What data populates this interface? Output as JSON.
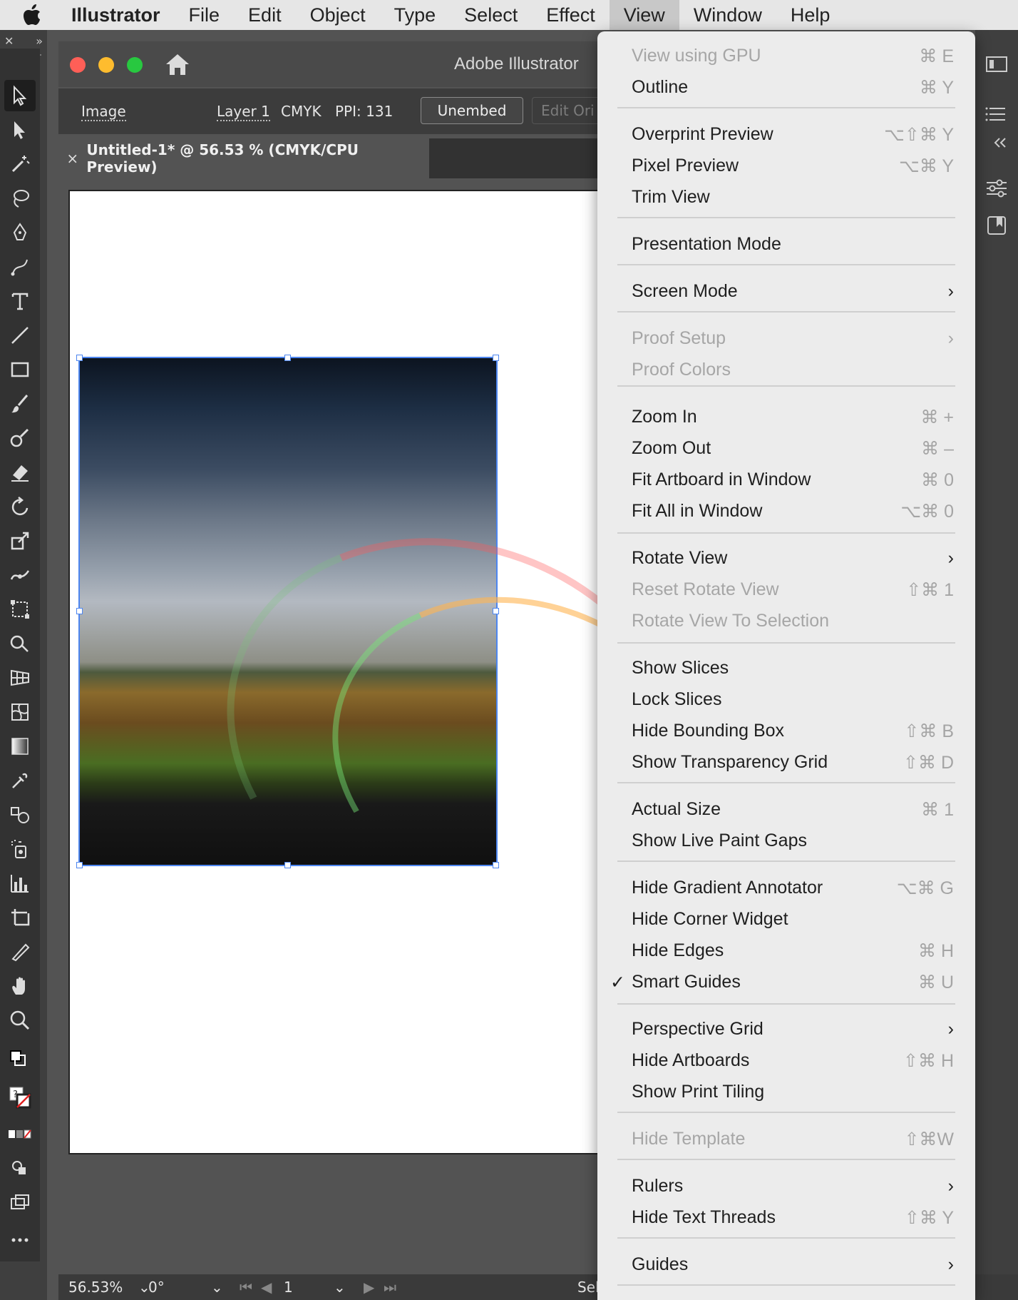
{
  "menubar": {
    "app_name": "Illustrator",
    "items": [
      "File",
      "Edit",
      "Object",
      "Type",
      "Select",
      "Effect",
      "View",
      "Window",
      "Help"
    ],
    "active": "View"
  },
  "window": {
    "title": "Adobe Illustrator"
  },
  "control_bar": {
    "object_type": "Image",
    "layer": "Layer 1",
    "color_mode": "CMYK",
    "ppi": "PPI: 131",
    "unembed_label": "Unembed",
    "edit_original_label": "Edit Ori"
  },
  "document_tab": {
    "close_glyph": "×",
    "title": "Untitled-1* @ 56.53 % (CMYK/CPU Preview)"
  },
  "status_bar": {
    "zoom": "56.53%",
    "rotation": "0°",
    "artboard_number": "1",
    "selection_text": "Sel"
  },
  "view_menu": {
    "check_glyph": "✓",
    "chevron_glyph": "›",
    "items": [
      {
        "label": "View using GPU",
        "shortcut": "⌘ E",
        "disabled": true
      },
      {
        "label": "Outline",
        "shortcut": "⌘ Y"
      },
      {
        "label": "Overprint Preview",
        "shortcut": "⌥⇧⌘ Y"
      },
      {
        "label": "Pixel Preview",
        "shortcut": "⌥⌘ Y"
      },
      {
        "label": "Trim View",
        "shortcut": ""
      },
      {
        "label": "Presentation Mode",
        "shortcut": ""
      },
      {
        "label": "Screen Mode",
        "submenu": true
      },
      {
        "label": "Proof Setup",
        "submenu": true,
        "disabled": true
      },
      {
        "label": "Proof Colors",
        "disabled": true
      },
      {
        "label": "Zoom In",
        "shortcut": "⌘ +"
      },
      {
        "label": "Zoom Out",
        "shortcut": "⌘ –"
      },
      {
        "label": "Fit Artboard in Window",
        "shortcut": "⌘ 0"
      },
      {
        "label": "Fit All in Window",
        "shortcut": "⌥⌘ 0"
      },
      {
        "label": "Rotate View",
        "submenu": true
      },
      {
        "label": "Reset Rotate View",
        "shortcut": "⇧⌘ 1",
        "disabled": true
      },
      {
        "label": "Rotate View To Selection",
        "disabled": true
      },
      {
        "label": "Show Slices"
      },
      {
        "label": "Lock Slices"
      },
      {
        "label": "Hide Bounding Box",
        "shortcut": "⇧⌘ B"
      },
      {
        "label": "Show Transparency Grid",
        "shortcut": "⇧⌘ D"
      },
      {
        "label": "Actual Size",
        "shortcut": "⌘ 1"
      },
      {
        "label": "Show Live Paint Gaps"
      },
      {
        "label": "Hide Gradient Annotator",
        "shortcut": "⌥⌘ G"
      },
      {
        "label": "Hide Corner Widget"
      },
      {
        "label": "Hide Edges",
        "shortcut": "⌘ H"
      },
      {
        "label": "Smart Guides",
        "shortcut": "⌘ U",
        "checked": true
      },
      {
        "label": "Perspective Grid",
        "submenu": true
      },
      {
        "label": "Hide Artboards",
        "shortcut": "⇧⌘ H"
      },
      {
        "label": "Show Print Tiling"
      },
      {
        "label": "Hide Template",
        "shortcut": "⇧⌘W",
        "disabled": true
      },
      {
        "label": "Rulers",
        "submenu": true
      },
      {
        "label": "Hide Text Threads",
        "shortcut": "⇧⌘ Y"
      },
      {
        "label": "Guides",
        "submenu": true
      }
    ]
  },
  "colors": {
    "selection_blue": "#4d86f0",
    "menu_bg": "#ececec",
    "traffic_close": "#ff5f57",
    "traffic_min": "#febc2e",
    "traffic_max": "#28c840"
  }
}
